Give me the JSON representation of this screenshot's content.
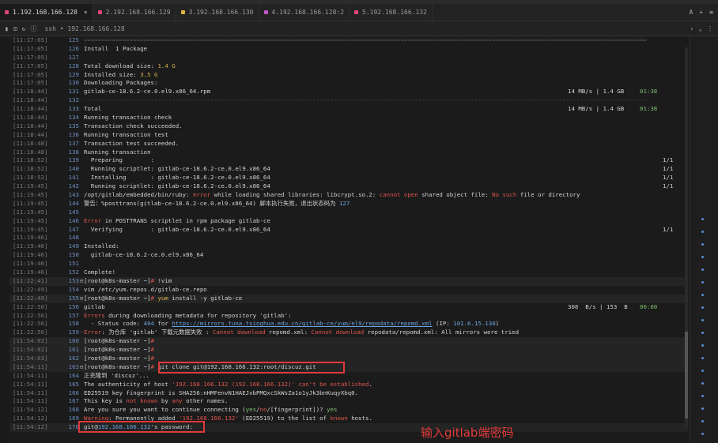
{
  "tabs": [
    {
      "label": "1.192.168.166.128",
      "color": "#e0467a",
      "active": true
    },
    {
      "label": "2.192.168.166.129",
      "color": "#e0467a",
      "active": false
    },
    {
      "label": "3.192.168.166.130",
      "color": "#e3b341",
      "active": false
    },
    {
      "label": "4.192.168.166.128:2",
      "color": "#c255c8",
      "active": false
    },
    {
      "label": "5.192.168.166.132",
      "color": "#e0467a",
      "active": false
    }
  ],
  "tab_close": "×",
  "tabbar_right": [
    "A",
    "+",
    "≡"
  ],
  "toolbar": {
    "path": "ssh  •  192.168.166.128"
  },
  "lines": [
    {
      "ts": "[11:17:05]",
      "n": "125",
      "segs": [
        {
          "t": "================================================================================================================================================================",
          "c": "sep"
        }
      ]
    },
    {
      "ts": "[11:17:05]",
      "n": "126",
      "segs": [
        {
          "t": "Install  1 Package"
        }
      ]
    },
    {
      "ts": "[11:17:05]",
      "n": "127",
      "segs": []
    },
    {
      "ts": "[11:17:05]",
      "n": "128",
      "segs": [
        {
          "t": "Total download size: "
        },
        {
          "t": "1.4 G",
          "c": "yel"
        }
      ]
    },
    {
      "ts": "[11:17:05]",
      "n": "129",
      "segs": [
        {
          "t": "Installed size: "
        },
        {
          "t": "3.5 G",
          "c": "yel"
        }
      ]
    },
    {
      "ts": "[11:17:05]",
      "n": "130",
      "segs": [
        {
          "t": "Downloading Packages:"
        }
      ]
    },
    {
      "ts": "[11:18:44]",
      "n": "131",
      "segs": [
        {
          "t": "gitlab-ce-18.6.2-ce.0.el9.x86_64.rpm"
        }
      ],
      "right": "14 MB/s | 1.4 GB",
      "rt": "01:38"
    },
    {
      "ts": "[11:18:44]",
      "n": "132",
      "segs": [
        {
          "t": "----------------------------------------------------------------------------------------------------------------------------------------------------------------",
          "c": "sep"
        }
      ]
    },
    {
      "ts": "[11:18:44]",
      "n": "133",
      "segs": [
        {
          "t": "Total"
        }
      ],
      "right": "14 MB/s | 1.4 GB",
      "rt": "01:38"
    },
    {
      "ts": "[11:18:44]",
      "n": "134",
      "segs": [
        {
          "t": "Running transaction check"
        }
      ]
    },
    {
      "ts": "[11:18:44]",
      "n": "135",
      "segs": [
        {
          "t": "Transaction check succeeded."
        }
      ]
    },
    {
      "ts": "[11:18:44]",
      "n": "136",
      "segs": [
        {
          "t": "Running transaction test"
        }
      ]
    },
    {
      "ts": "[11:18:48]",
      "n": "137",
      "segs": [
        {
          "t": "Transaction test succeeded."
        }
      ]
    },
    {
      "ts": "[11:18:48]",
      "n": "138",
      "segs": [
        {
          "t": "Running transaction"
        }
      ]
    },
    {
      "ts": "[11:18:52]",
      "n": "139",
      "segs": [
        {
          "t": "  Preparing        :"
        }
      ],
      "prog": "1/1"
    },
    {
      "ts": "[11:18:52]",
      "n": "140",
      "segs": [
        {
          "t": "  Running scriptlet: gitlab-ce-18.6.2-ce.0.el9.x86_64"
        }
      ],
      "prog": "1/1"
    },
    {
      "ts": "[11:18:52]",
      "n": "141",
      "segs": [
        {
          "t": "  Installing       : gitlab-ce-18.6.2-ce.0.el9.x86_64"
        }
      ],
      "prog": "1/1"
    },
    {
      "ts": "[11:19:45]",
      "n": "142",
      "segs": [
        {
          "t": "  Running scriptlet: gitlab-ce-18.6.2-ce.0.el9.x86_64"
        }
      ],
      "prog": "1/1"
    },
    {
      "ts": "[11:19:45]",
      "n": "143",
      "segs": [
        {
          "t": "/opt/gitlab/embedded/bin/ruby: "
        },
        {
          "t": "error",
          "c": "err"
        },
        {
          "t": " while loading shared libraries: libcrypt.so.2: "
        },
        {
          "t": "cannot open",
          "c": "err"
        },
        {
          "t": " shared object file: "
        },
        {
          "t": "No such",
          "c": "err"
        },
        {
          "t": " file or directory"
        }
      ]
    },
    {
      "ts": "[11:19:45]",
      "n": "144",
      "segs": [
        {
          "t": "警告：%posttrans(gitlab-ce-18.6.2-ce.0.el9.x86_64) 脚本执行失败，退出状态码为 "
        },
        {
          "t": "127",
          "c": "blue"
        }
      ]
    },
    {
      "ts": "[11:19:45]",
      "n": "145",
      "segs": []
    },
    {
      "ts": "[11:19:45]",
      "n": "146",
      "segs": [
        {
          "t": "Error",
          "c": "err"
        },
        {
          "t": " in POSTTRANS scriptlet in rpm package gitlab-ce"
        }
      ]
    },
    {
      "ts": "[11:19:45]",
      "n": "147",
      "segs": [
        {
          "t": "  Verifying        : gitlab-ce-18.6.2-ce.0.el9.x86_64"
        }
      ],
      "prog": "1/1"
    },
    {
      "ts": "[11:19:46]",
      "n": "148",
      "segs": []
    },
    {
      "ts": "[11:19:46]",
      "n": "149",
      "segs": [
        {
          "t": "Installed:"
        }
      ]
    },
    {
      "ts": "[11:19:46]",
      "n": "150",
      "segs": [
        {
          "t": "  gitlab-ce-18.6.2-ce.0.el9.x86_64"
        }
      ]
    },
    {
      "ts": "[11:19:46]",
      "n": "151",
      "segs": []
    },
    {
      "ts": "[11:19:46]",
      "n": "152",
      "segs": [
        {
          "t": "Complete!"
        }
      ]
    },
    {
      "ts": "[11:22:41]",
      "n": "153",
      "mk": "⊟",
      "hl": true,
      "segs": [
        {
          "t": "[root@k8s-master ~]"
        },
        {
          "t": "# ",
          "c": "err"
        },
        {
          "t": "!vim"
        }
      ]
    },
    {
      "ts": "[11:22:49]",
      "n": "154",
      "segs": [
        {
          "t": "vim /etc/yum.repos.d/gitlab-ce.repo"
        }
      ]
    },
    {
      "ts": "[11:22:49]",
      "n": "155",
      "mk": "⊟",
      "hl": true,
      "segs": [
        {
          "t": "[root@k8s-master ~]"
        },
        {
          "t": "# ",
          "c": "err"
        },
        {
          "t": "yum",
          "c": "yel"
        },
        {
          "t": " install -y gitlab-ce"
        }
      ]
    },
    {
      "ts": "[11:22:50]",
      "n": "156",
      "segs": [
        {
          "t": "gitlab"
        }
      ],
      "right": "308  B/s | 153  B",
      "rt": "00:00",
      "rtc": "grn"
    },
    {
      "ts": "[11:22:50]",
      "n": "157",
      "segs": [
        {
          "t": "Errors",
          "c": "err"
        },
        {
          "t": " during downloading metadata for repository 'gitlab':"
        }
      ]
    },
    {
      "ts": "[11:22:50]",
      "n": "158",
      "segs": [
        {
          "t": "  - Status code: "
        },
        {
          "t": "404",
          "c": "blue"
        },
        {
          "t": " for "
        },
        {
          "t": "https://mirrors.tuna.tsinghua.edu.cn/gitlab-ce/yum/el9/repodata/repomd.xml",
          "c": "link"
        },
        {
          "t": " (IP: "
        },
        {
          "t": "101.6.15.130",
          "c": "blue"
        },
        {
          "t": ")"
        }
      ]
    },
    {
      "ts": "[11:22:50]",
      "n": "159",
      "mk": "-",
      "segs": [
        {
          "t": "Error",
          "c": "err"
        },
        {
          "t": ": 为仓库 'gitlab' 下载元数据失败 : "
        },
        {
          "t": "Cannot download",
          "c": "err"
        },
        {
          "t": " repomd.xml: "
        },
        {
          "t": "Cannot download",
          "c": "err"
        },
        {
          "t": " repodata/repomd.xml: All mirrors were tried"
        }
      ]
    },
    {
      "ts": "[11:54:02]",
      "n": "160",
      "hl": true,
      "segs": [
        {
          "t": "[root@k8s-master ~]"
        },
        {
          "t": "#",
          "c": "err"
        }
      ]
    },
    {
      "ts": "[11:54:02]",
      "n": "161",
      "hl": true,
      "segs": [
        {
          "t": "[root@k8s-master ~]"
        },
        {
          "t": "#",
          "c": "err"
        }
      ]
    },
    {
      "ts": "[11:54:03]",
      "n": "162",
      "hl": true,
      "segs": [
        {
          "t": "[root@k8s-master ~]"
        },
        {
          "t": "#",
          "c": "err"
        }
      ]
    },
    {
      "ts": "[11:54:11]",
      "n": "163",
      "mk": "⊟",
      "hl": true,
      "segs": [
        {
          "t": "[root@k8s-master ~]"
        },
        {
          "t": "# ",
          "c": "err"
        },
        {
          "t": "git clone git@192.168.166.132:root/discuz.git"
        }
      ]
    },
    {
      "ts": "[11:54:11]",
      "n": "164",
      "segs": [
        {
          "t": "正克隆到 'discuz'..."
        }
      ]
    },
    {
      "ts": "[11:54:11]",
      "n": "165",
      "segs": [
        {
          "t": "The authenticity of host "
        },
        {
          "t": "'192.168.166.132 (192.168.166.132)'",
          "c": "err"
        },
        {
          "t": " can't be established",
          "c": "err"
        },
        {
          "t": "."
        }
      ]
    },
    {
      "ts": "[11:54:11]",
      "n": "166",
      "segs": [
        {
          "t": "ED25519 key fingerprint is SHA256:nHMFenvN1HAEJvbPMQxcSkWsZa1o1yJk3bnKuqyXbq0."
        }
      ]
    },
    {
      "ts": "[11:54:11]",
      "n": "167",
      "segs": [
        {
          "t": "This key is "
        },
        {
          "t": "not known",
          "c": "err"
        },
        {
          "t": " by "
        },
        {
          "t": "any",
          "c": "err"
        },
        {
          "t": " other names."
        }
      ]
    },
    {
      "ts": "[11:54:12]",
      "n": "168",
      "segs": [
        {
          "t": "Are you sure you want to continue connecting ("
        },
        {
          "t": "yes",
          "c": "grn"
        },
        {
          "t": "/"
        },
        {
          "t": "no",
          "c": "err"
        },
        {
          "t": "/[fingerprint])? "
        },
        {
          "t": "yes",
          "c": "grn"
        }
      ]
    },
    {
      "ts": "[11:54:12]",
      "n": "169",
      "segs": [
        {
          "t": "Warning",
          "c": "err"
        },
        {
          "t": ": Permanently added "
        },
        {
          "t": "'192.168.166.132'",
          "c": "err"
        },
        {
          "t": " (ED25519) to the list of "
        },
        {
          "t": "known",
          "c": "err"
        },
        {
          "t": " hosts."
        }
      ]
    },
    {
      "ts": "[11:54:12]",
      "n": "170",
      "hl": true,
      "segs": [
        {
          "t": "git@"
        },
        {
          "t": "192.168.166.132",
          "c": "blue"
        },
        {
          "t": "'s password:"
        }
      ]
    }
  ],
  "annotation": "输入gitlab端密码"
}
